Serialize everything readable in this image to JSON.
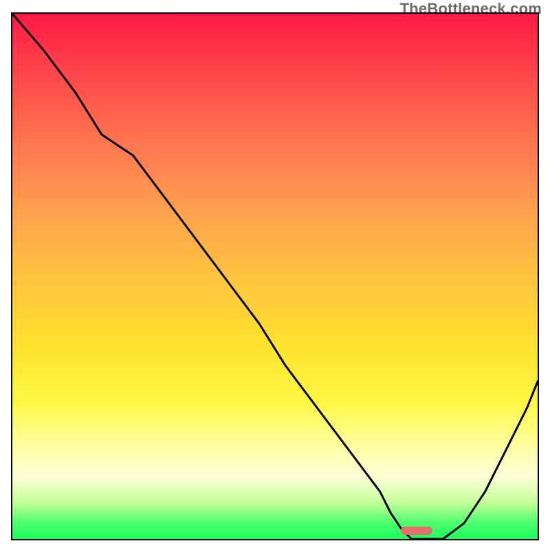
{
  "watermark": "TheBottleneck.com",
  "chart_data": {
    "type": "line",
    "x": [
      0.0,
      0.06,
      0.12,
      0.17,
      0.23,
      0.29,
      0.35,
      0.41,
      0.47,
      0.52,
      0.58,
      0.64,
      0.7,
      0.72,
      0.74,
      0.76,
      0.78,
      0.8,
      0.82,
      0.86,
      0.9,
      0.94,
      0.98,
      1.0
    ],
    "y": [
      1.0,
      0.93,
      0.85,
      0.77,
      0.73,
      0.65,
      0.57,
      0.49,
      0.41,
      0.33,
      0.25,
      0.17,
      0.09,
      0.05,
      0.02,
      0.0,
      0.0,
      0.0,
      0.0,
      0.03,
      0.09,
      0.17,
      0.25,
      0.3
    ],
    "title": "",
    "xlabel": "",
    "ylabel": "",
    "xlim": [
      0,
      1
    ],
    "ylim": [
      0,
      1
    ],
    "highlight_band_x": [
      0.74,
      0.8
    ]
  }
}
